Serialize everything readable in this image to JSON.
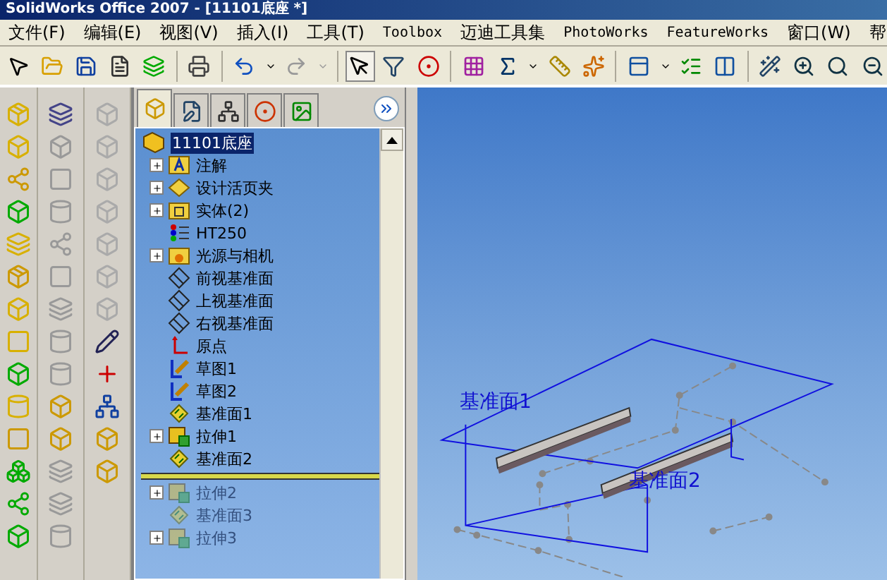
{
  "window": {
    "title": "SolidWorks Office 2007 - [11101底座 *]"
  },
  "menu": [
    "文件(F)",
    "编辑(E)",
    "视图(V)",
    "插入(I)",
    "工具(T)",
    "Toolbox",
    "迈迪工具集",
    "PhotoWorks",
    "FeatureWorks",
    "窗口(W)",
    "帮"
  ],
  "feature_manager": {
    "tabs": [
      {
        "selected": true
      },
      {
        "selected": false
      },
      {
        "selected": false
      },
      {
        "selected": false
      },
      {
        "selected": false
      }
    ],
    "root": {
      "label": "11101底座",
      "selected": true
    },
    "items": [
      {
        "kind": "annotations",
        "label": "注解",
        "expandable": true,
        "rolled_back": false
      },
      {
        "kind": "binder",
        "label": "设计活页夹",
        "expandable": true,
        "rolled_back": false
      },
      {
        "kind": "bodies",
        "label": "实体(2)",
        "expandable": true,
        "rolled_back": false
      },
      {
        "kind": "material",
        "label": "HT250",
        "expandable": false,
        "rolled_back": false
      },
      {
        "kind": "lights",
        "label": "光源与相机",
        "expandable": true,
        "rolled_back": false
      },
      {
        "kind": "plane",
        "label": "前视基准面",
        "expandable": false,
        "rolled_back": false
      },
      {
        "kind": "plane",
        "label": "上视基准面",
        "expandable": false,
        "rolled_back": false
      },
      {
        "kind": "plane",
        "label": "右视基准面",
        "expandable": false,
        "rolled_back": false
      },
      {
        "kind": "origin",
        "label": "原点",
        "expandable": false,
        "rolled_back": false
      },
      {
        "kind": "sketch",
        "label": "草图1",
        "expandable": false,
        "rolled_back": false
      },
      {
        "kind": "sketch",
        "label": "草图2",
        "expandable": false,
        "rolled_back": false
      },
      {
        "kind": "refplane",
        "label": "基准面1",
        "expandable": false,
        "rolled_back": false
      },
      {
        "kind": "extrude",
        "label": "拉伸1",
        "expandable": true,
        "rolled_back": false
      },
      {
        "kind": "refplane",
        "label": "基准面2",
        "expandable": false,
        "rolled_back": false
      },
      {
        "kind": "rollback"
      },
      {
        "kind": "extrude",
        "label": "拉伸2",
        "expandable": true,
        "rolled_back": true
      },
      {
        "kind": "refplane",
        "label": "基准面3",
        "expandable": false,
        "rolled_back": true
      },
      {
        "kind": "extrude",
        "label": "拉伸3",
        "expandable": true,
        "rolled_back": true
      }
    ]
  },
  "viewport": {
    "labels": [
      "基准面1",
      "基准面2"
    ]
  }
}
